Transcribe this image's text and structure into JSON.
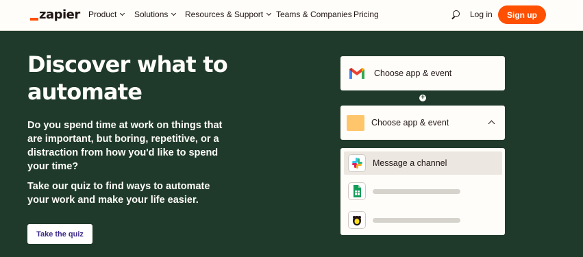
{
  "nav": {
    "logo": "zapier",
    "items": [
      "Product",
      "Solutions",
      "Resources & Support",
      "Teams & Companies",
      "Pricing"
    ],
    "login": "Log in",
    "signup": "Sign up"
  },
  "hero": {
    "title": "Discover what to automate",
    "para1": "Do you spend time at work on things that are important, but boring, repetitive, or a distraction from how you'd like to spend your time?",
    "para2": "Take our quiz to find ways to automate your work and make your life easier.",
    "cta": "Take the quiz"
  },
  "builder": {
    "trigger_label": "Choose app & event",
    "action_label": "Choose app & event",
    "options": [
      {
        "label": "Message a channel",
        "icon": "slack-icon"
      },
      {
        "label": "",
        "icon": "google-sheets-icon"
      },
      {
        "label": "",
        "icon": "mailchimp-icon"
      }
    ]
  },
  "colors": {
    "brand": "#ff4f00",
    "hero_bg": "#1f3a2b",
    "cream": "#fffdf9"
  }
}
